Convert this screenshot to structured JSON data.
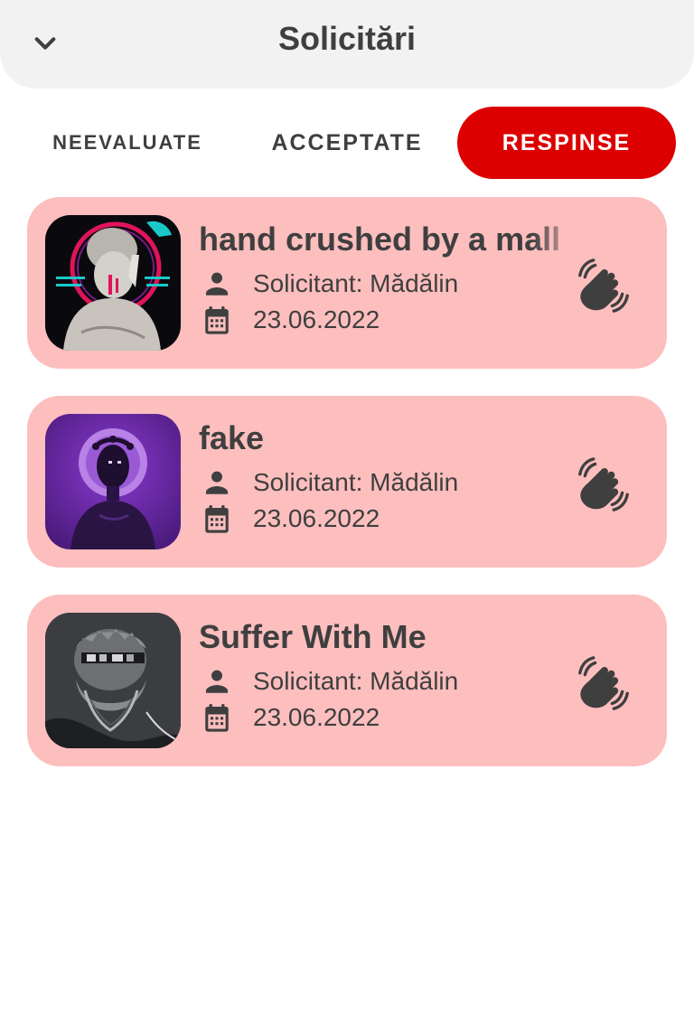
{
  "header": {
    "title": "Solicitări",
    "back_icon": "chevron-down-icon"
  },
  "tabs": [
    {
      "label": "NEEVALUATE",
      "active": false
    },
    {
      "label": "ACCEPTATE",
      "active": false
    },
    {
      "label": "RESPINSE",
      "active": true
    }
  ],
  "colors": {
    "accent": "#dc0000",
    "card_background": "#fdbebe",
    "header_background": "#f2f2f2",
    "text": "#3f3f3f"
  },
  "requests": [
    {
      "title": "hand crushed by a mall",
      "requester": "Solicitant: Mădălin",
      "date": "23.06.2022",
      "requester_icon": "person-icon",
      "date_icon": "calendar-icon",
      "action_icon": "waving-hand-icon"
    },
    {
      "title": "fake",
      "requester": "Solicitant: Mădălin",
      "date": "23.06.2022",
      "requester_icon": "person-icon",
      "date_icon": "calendar-icon",
      "action_icon": "waving-hand-icon"
    },
    {
      "title": "Suffer With Me",
      "requester": "Solicitant: Mădălin",
      "date": "23.06.2022",
      "requester_icon": "person-icon",
      "date_icon": "calendar-icon",
      "action_icon": "waving-hand-icon"
    }
  ]
}
